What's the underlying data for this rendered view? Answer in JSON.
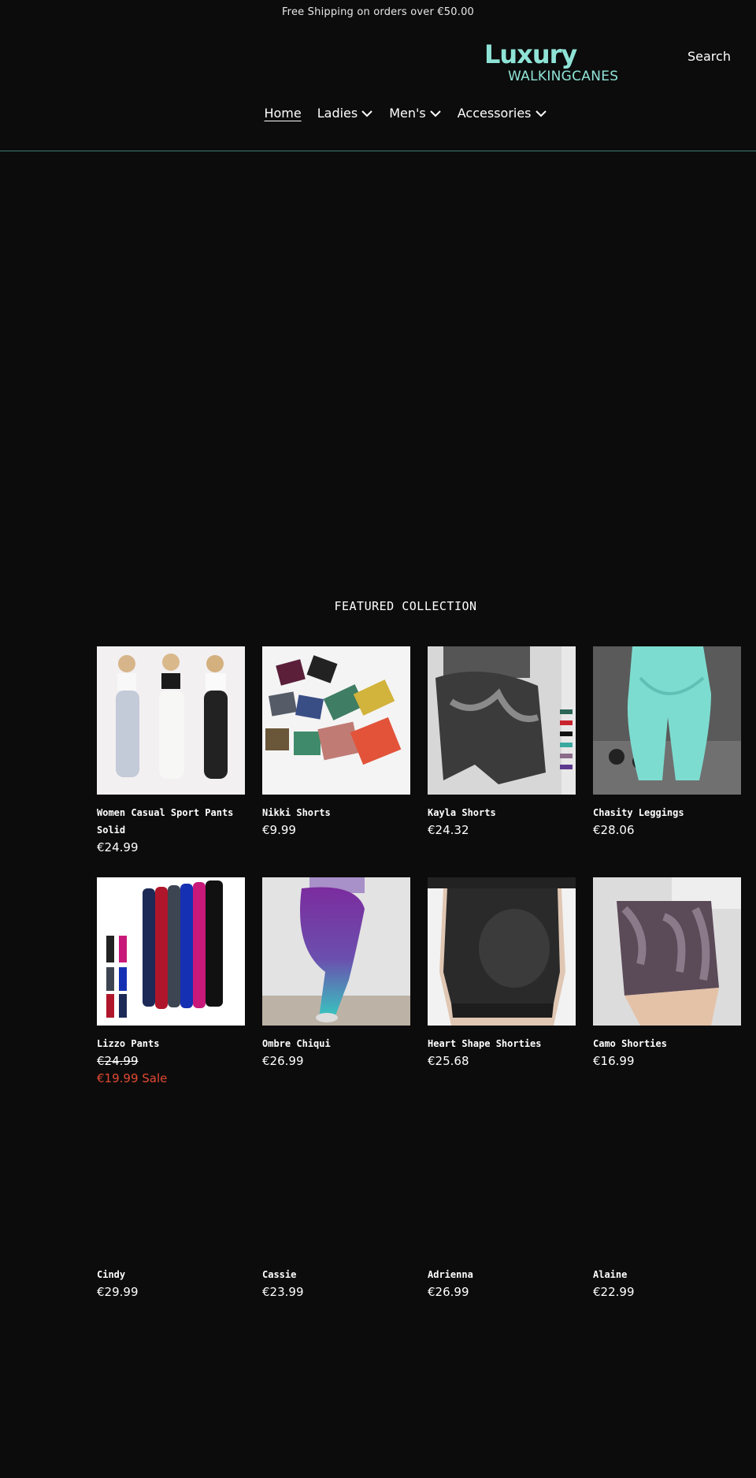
{
  "announcement": "Free Shipping on orders over €50.00",
  "logo": {
    "line1": "Luxury",
    "line2": "WALKINGCANES"
  },
  "header": {
    "search_label": "Search"
  },
  "nav": [
    {
      "label": "Home",
      "active": true
    },
    {
      "label": "Ladies"
    },
    {
      "label": "Men's"
    },
    {
      "label": "Accessories"
    }
  ],
  "colors": {
    "background": "#0c0c0c",
    "accent": "#8fe3d6",
    "sale": "#e24a33",
    "rule": "#3d7f70"
  },
  "featured": {
    "title": "FEATURED COLLECTION",
    "products": [
      {
        "name": "Women Casual Sport Pants Solid",
        "price": "€24.99"
      },
      {
        "name": "Nikki Shorts",
        "price": "€9.99"
      },
      {
        "name": "Kayla Shorts",
        "price": "€24.32"
      },
      {
        "name": "Chasity Leggings",
        "price": "€28.06"
      },
      {
        "name": "Lizzo Pants",
        "compare_price": "€24.99",
        "sale_price": "€19.99 Sale"
      },
      {
        "name": "Ombre Chiqui",
        "price": "€26.99"
      },
      {
        "name": "Heart Shape Shorties",
        "price": "€25.68"
      },
      {
        "name": "Camo Shorties",
        "price": "€16.99"
      },
      {
        "name": "Cindy",
        "price": "€29.99"
      },
      {
        "name": "Cassie",
        "price": "€23.99"
      },
      {
        "name": "Adrienna",
        "price": "€26.99"
      },
      {
        "name": "Alaine",
        "price": "€22.99"
      }
    ]
  }
}
